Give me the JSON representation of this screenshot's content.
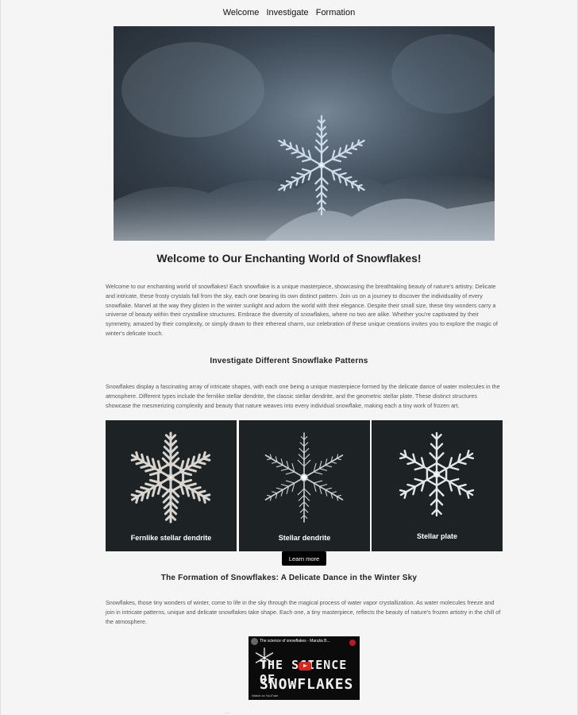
{
  "nav": {
    "items": [
      {
        "label": "Welcome"
      },
      {
        "label": "Investigate"
      },
      {
        "label": "Formation"
      }
    ]
  },
  "hero": {
    "alt": "Close-up of a snowflake on frost"
  },
  "welcome": {
    "title": "Welcome to Our Enchanting World of Snowflakes!",
    "body": "Welcome to our enchanting world of snowflakes! Each snowflake is a unique masterpiece, showcasing the breathtaking beauty of nature's artistry. Delicate and intricate, these frosty crystals fall from the sky, each one bearing its own distinct pattern. Join us on a journey to discover the individuality of every snowflake. Marvel at the way they glisten in the winter sunlight and adorn the world with their elegance. Despite their small size, these tiny wonders carry a universe of beauty within their crystalline structures. Embrace the diversity of snowflakes, where no two are alike. Whether you're captivated by their symmetry, amazed by their complexity, or simply drawn to their ethereal charm, our celebration of these unique creations invites you to explore the magic of winter's delicate touch."
  },
  "investigate": {
    "title": "Investigate Different Snowflake Patterns",
    "body": "Snowflakes display a fascinating array of intricate shapes, with each one being a unique masterpiece formed by the delicate dance of water molecules in the atmosphere. Different types include the fernlike stellar dendrite, the classic stellar dendrite, and the geometric stellar plate. These distinct structures showcase the mesmerizing complexity and beauty that nature weaves into every individual snowflake, making each a tiny work of frozen art.",
    "gallery": [
      {
        "caption": "Fernlike stellar dendrite"
      },
      {
        "caption": "Stellar dendrite"
      },
      {
        "caption": "Stellar plate"
      }
    ],
    "button_label": "Learn more"
  },
  "formation": {
    "title": "The Formation of Snowflakes: A Delicate Dance in the Winter Sky",
    "body": "Snowflakes, those tiny wonders of winter, come to life in the sky through the magical process of water vapor crystallization. As water molecules freeze and join in intricate patterns, unique and delicate snowflakes take shape. Each one, a tiny masterpiece, reflects the beauty of nature's frozen artistry in the chill of the atmosphere.",
    "video": {
      "title": "The science of snowflakes - Maruša B...",
      "line1": "THE SCIENCE OF",
      "line2": "SNOWFLAKES",
      "watch": "Watch on YouTube"
    }
  },
  "colors": {
    "background": "#f5f5f5",
    "button": "#000000",
    "card": "#1d2225",
    "youtube_red": "#e62117"
  }
}
